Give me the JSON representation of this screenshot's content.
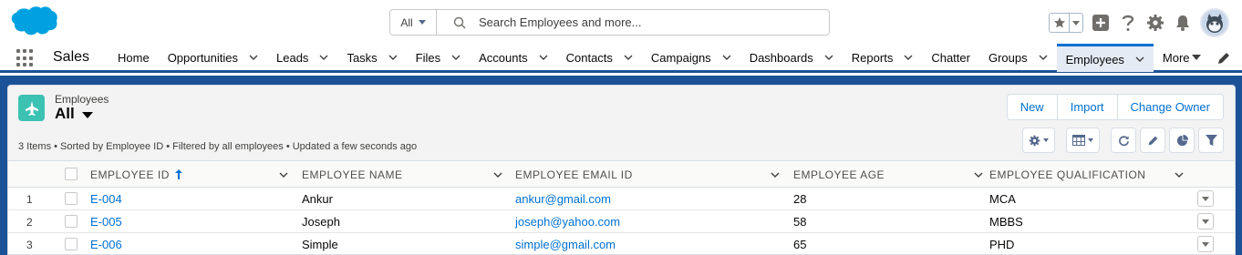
{
  "header": {
    "search_scope": "All",
    "search_placeholder": "Search Employees and more..."
  },
  "nav": {
    "app_name": "Sales",
    "items": [
      {
        "label": "Home",
        "has_menu": false
      },
      {
        "label": "Opportunities",
        "has_menu": true
      },
      {
        "label": "Leads",
        "has_menu": true
      },
      {
        "label": "Tasks",
        "has_menu": true
      },
      {
        "label": "Files",
        "has_menu": true
      },
      {
        "label": "Accounts",
        "has_menu": true
      },
      {
        "label": "Contacts",
        "has_menu": true
      },
      {
        "label": "Campaigns",
        "has_menu": true
      },
      {
        "label": "Dashboards",
        "has_menu": true
      },
      {
        "label": "Reports",
        "has_menu": true
      },
      {
        "label": "Chatter",
        "has_menu": false
      },
      {
        "label": "Groups",
        "has_menu": true
      },
      {
        "label": "Employees",
        "has_menu": true,
        "active": true
      }
    ],
    "more_label": "More"
  },
  "list": {
    "object_label": "Employees",
    "view_name": "All",
    "buttons": {
      "new": "New",
      "import": "Import",
      "change_owner": "Change Owner"
    },
    "meta": "3 Items • Sorted by Employee ID • Filtered by all employees • Updated a few seconds ago",
    "columns": [
      "EMPLOYEE ID",
      "EMPLOYEE NAME",
      "EMPLOYEE EMAIL ID",
      "EMPLOYEE AGE",
      "EMPLOYEE QUALIFICATION"
    ],
    "rows": [
      {
        "num": "1",
        "id": "E-004",
        "name": "Ankur",
        "email": "ankur@gmail.com",
        "age": "28",
        "qual": "MCA"
      },
      {
        "num": "2",
        "id": "E-005",
        "name": "Joseph",
        "email": "joseph@yahoo.com",
        "age": "58",
        "qual": "MBBS"
      },
      {
        "num": "3",
        "id": "E-006",
        "name": "Simple",
        "email": "simple@gmail.com",
        "age": "65",
        "qual": "PHD"
      }
    ]
  },
  "colors": {
    "brand_blue": "#1b5297",
    "link": "#0070d2",
    "object_icon": "#3cc2b3",
    "salesforce_cloud": "#00a1e0"
  }
}
